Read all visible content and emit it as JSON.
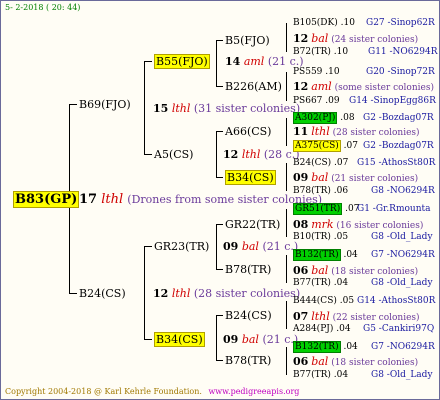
{
  "header": {
    "date_line": "5-  2-2018 ( 20: 44)"
  },
  "footer": {
    "copyright": "Copyright 2004-2018 @ Karl Kehrle Foundation.",
    "website": "www.pedigreeapis.org"
  },
  "root": {
    "name": "B83(GP)",
    "year": "17",
    "breeder": "lthl",
    "note": "(Drones from some sister colonies)"
  },
  "gen1": [
    {
      "name": "B69(FJO)",
      "year": "15",
      "breeder": "lthl",
      "note": "(31 sister colonies)"
    },
    {
      "name": "B24(CS)",
      "year": "12",
      "breeder": "lthl",
      "note": "(28 sister colonies)"
    }
  ],
  "gen2": [
    {
      "name": "B55(FJO)",
      "year": "14",
      "breeder": "aml",
      "note": "(21 c.)"
    },
    {
      "name": "A5(CS)",
      "year": "12",
      "breeder": "lthl",
      "note": "(28 c.)"
    },
    {
      "name": "GR23(TR)",
      "year": "09",
      "breeder": "bal",
      "note": "(21 c.)"
    },
    {
      "name": "B34(CS)",
      "year": "09",
      "breeder": "bal",
      "note": "(21 c.)"
    }
  ],
  "gen3": [
    {
      "name": "B5(FJO)",
      "year": "12",
      "breeder": "bal",
      "note": "(24 sister colonies)"
    },
    {
      "name": "B226(AM)",
      "year": "12",
      "breeder": "aml",
      "note": "(some sister colonies)"
    },
    {
      "name": "A66(CS)",
      "year": "11",
      "breeder": "lthl",
      "note": "(28 sister colonies)"
    },
    {
      "name": "B34(CS)",
      "year": "09",
      "breeder": "bal",
      "note": "(21 sister colonies)"
    },
    {
      "name": "GR22(TR)",
      "year": "08",
      "breeder": "mrk",
      "note": "(16 sister colonies)"
    },
    {
      "name": "B78(TR)",
      "year": "06",
      "breeder": "bal",
      "note": "(18 sister colonies)"
    },
    {
      "name": "B24(CS)",
      "year": "07",
      "breeder": "lthl",
      "note": "(22 sister colonies)"
    },
    {
      "name": "B78(TR)",
      "year": "06",
      "breeder": "bal",
      "note": "(18 sister colonies)"
    }
  ],
  "gen4": [
    {
      "name": "B105(DK)",
      "year": ".10",
      "ref": "G27 -Sinop62R"
    },
    {
      "name": "B72(TR)",
      "year": ".10",
      "ref": "G11 -NO6294R"
    },
    {
      "name": "PS559",
      "year": ".10",
      "ref": "G20 -Sinop72R"
    },
    {
      "name": "PS667",
      "year": ".09",
      "ref": "G14 -SinopEgg86R"
    },
    {
      "name": "A302(PJ)",
      "year": ".08",
      "ref": "G2 -Bozdag07R"
    },
    {
      "name": "A375(CS)",
      "year": ".07",
      "ref": "G2 -Bozdag07R"
    },
    {
      "name": "B24(CS)",
      "year": ".07",
      "ref": "G15 -AthosSt80R"
    },
    {
      "name": "B78(TR)",
      "year": ".06",
      "ref": "G8 -NO6294R"
    },
    {
      "name": "GR51(TR)",
      "year": ".07",
      "ref": "G1 -Gr.Rmounta"
    },
    {
      "name": "B10(TR)",
      "year": ".05",
      "ref": "G8 -Old_Lady"
    },
    {
      "name": "B132(TR)",
      "year": ".04",
      "ref": "G7 -NO6294R"
    },
    {
      "name": "B77(TR)",
      "year": ".04",
      "ref": "G8 -Old_Lady"
    },
    {
      "name": "B444(CS)",
      "year": ".05",
      "ref": "G14 -AthosSt80R"
    },
    {
      "name": "A284(PJ)",
      "year": ".04",
      "ref": "G5 -Cankiri97Q"
    },
    {
      "name": "B132(TR)",
      "year": ".04",
      "ref": "G7 -NO6294R"
    },
    {
      "name": "B77(TR)",
      "year": ".04",
      "ref": "G8 -Old_Lady"
    }
  ]
}
